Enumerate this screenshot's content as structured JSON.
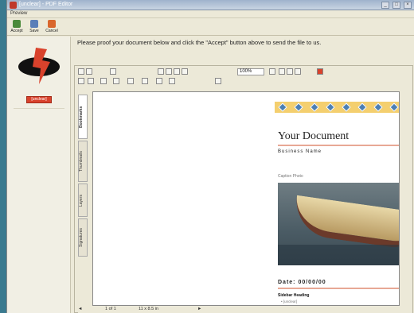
{
  "window": {
    "title": "[unclear] - PDF Editor",
    "min": "_",
    "max": "□",
    "close": "×"
  },
  "menu": {
    "preview": "Preview"
  },
  "toolbar": {
    "accept": "Accept",
    "save": "Save",
    "cancel": "Cancel",
    "accept_color": "#4a8a3a",
    "save_color": "#5a7fb8",
    "cancel_color": "#d9662c"
  },
  "left": {
    "button_label": "[unclear]",
    "logo_icon": "brand-logo-icon"
  },
  "instruction": "Please proof your document below and click the \"Accept\" button above to send the file to us.",
  "viewer": {
    "zoom": "100%",
    "tabs": [
      "Bookmarks",
      "Thumbnails",
      "Layers",
      "Signatures"
    ],
    "active_tab": "Bookmarks",
    "page_indicator": "1 of 1",
    "page_size": "11 x 8.5 in"
  },
  "document": {
    "title": "Your Document",
    "business_name": "Business Name",
    "caption": "Caption Photo",
    "date": "Date: 00/00/00",
    "subheading": "Sidebar Heading",
    "bullet": "• [unclear]"
  },
  "colors": {
    "accent": "#e8a895",
    "banner": "#f4cf6f",
    "diamond": "#4d7fb3",
    "brand_red": "#d9422c"
  }
}
